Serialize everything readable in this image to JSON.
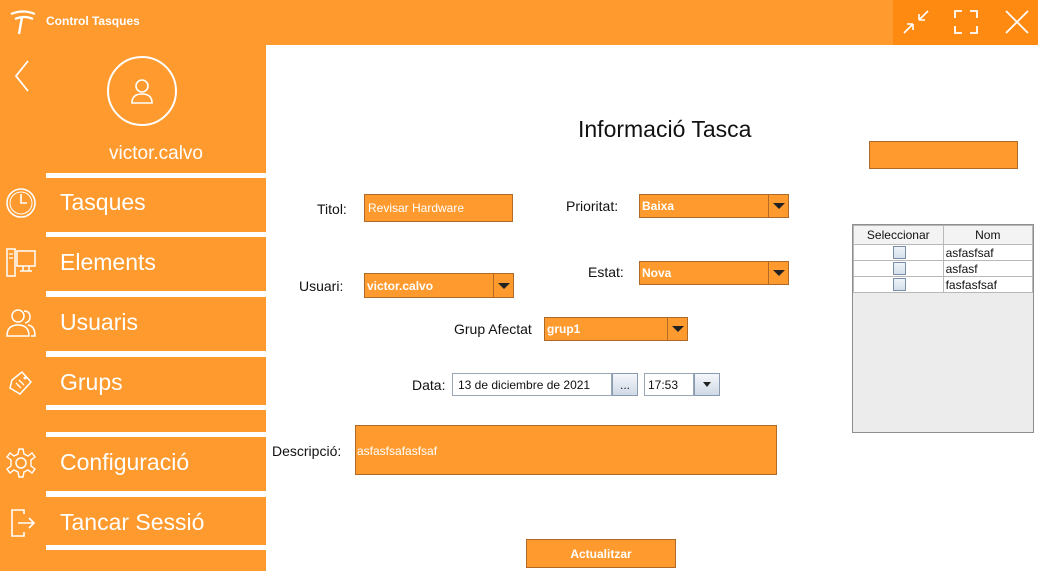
{
  "window": {
    "title": "Control Tasques",
    "logo_icon": "brand-logo-icon",
    "controls": [
      "minimize-icon",
      "maximize-icon",
      "close-icon"
    ],
    "accent_color": "#ff9a2e",
    "controls_bg_color": "#ff8a12"
  },
  "sidebar": {
    "back_icon": "chevron-left-icon",
    "avatar_icon": "user-avatar-icon",
    "username": "victor.calvo",
    "items": [
      {
        "label": "Tasques",
        "icon": "clock-icon"
      },
      {
        "label": "Elements",
        "icon": "computer-icon"
      },
      {
        "label": "Usuaris",
        "icon": "users-icon"
      },
      {
        "label": "Grups",
        "icon": "tag-icon"
      },
      {
        "label": "Configuració",
        "icon": "gear-icon"
      },
      {
        "label": "Tancar Sessió",
        "icon": "logout-icon"
      }
    ]
  },
  "form": {
    "heading": "Informació Tasca",
    "title_label": "Titol:",
    "title_value": "Revisar Hardware",
    "priority_label": "Prioritat:",
    "priority_value": "Baixa",
    "user_label": "Usuari:",
    "user_value": "victor.calvo",
    "state_label": "Estat:",
    "state_value": "Nova",
    "group_label": "Grup Afectat",
    "group_value": "grup1",
    "date_label": "Data:",
    "date_value": "13 de diciembre de 2021",
    "date_button": "...",
    "time_value": "17:53",
    "description_label": "Descripció:",
    "description_value": "asfasfsafasfsaf",
    "update_button": "Actualitzar"
  },
  "members_table": {
    "columns": [
      "Seleccionar",
      "Nom"
    ],
    "rows": [
      {
        "selected": false,
        "name": "asfasfsaf"
      },
      {
        "selected": false,
        "name": "asfasf"
      },
      {
        "selected": false,
        "name": "fasfasfsaf"
      }
    ]
  }
}
